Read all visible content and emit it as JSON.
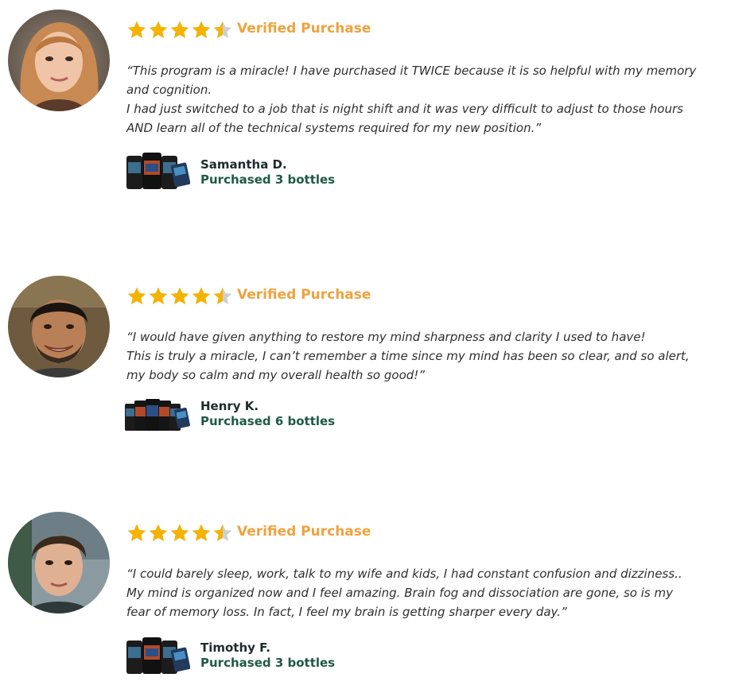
{
  "colors": {
    "star_gold": "#f5b301",
    "star_empty": "#cfcfcf",
    "verified_orange": "#f0a23e",
    "name_dark": "#1d2b2a",
    "purchased_green": "#1f5a44"
  },
  "reviews": [
    {
      "rating": 4.5,
      "verified_label": "Verified Purchase",
      "quote_lines": [
        "“This program is a miracle! I have purchased it TWICE because it is so helpful with my memory",
        "and cognition.",
        "I had just switched to a job that is night shift and it was very difficult to adjust to those hours",
        "AND learn all of the technical systems required for my new position.”"
      ],
      "name": "Samantha D.",
      "purchased": "Purchased 3 bottles",
      "product_icon": "three-bottle-pack-icon"
    },
    {
      "rating": 4.5,
      "verified_label": "Verified Purchase",
      "quote_lines": [
        "“I would have given anything to restore my mind sharpness and clarity I used to have!",
        "This is truly a miracle, I can’t remember a time since my mind has been so clear, and so alert,",
        "my body so calm and my overall health so good!”"
      ],
      "name": "Henry K.",
      "purchased": "Purchased 6 bottles",
      "product_icon": "six-bottle-pack-icon"
    },
    {
      "rating": 4.5,
      "verified_label": "Verified Purchase",
      "quote_lines": [
        "“I could barely sleep, work, talk to my wife and kids, I had constant confusion and dizziness..",
        "My mind is organized now and I feel amazing. Brain fog and dissociation are gone, so is my",
        "fear of memory loss. In fact, I feel my brain is getting sharper every day.”"
      ],
      "name": "Timothy F.",
      "purchased": "Purchased 3 bottles",
      "product_icon": "three-bottle-pack-icon"
    }
  ]
}
